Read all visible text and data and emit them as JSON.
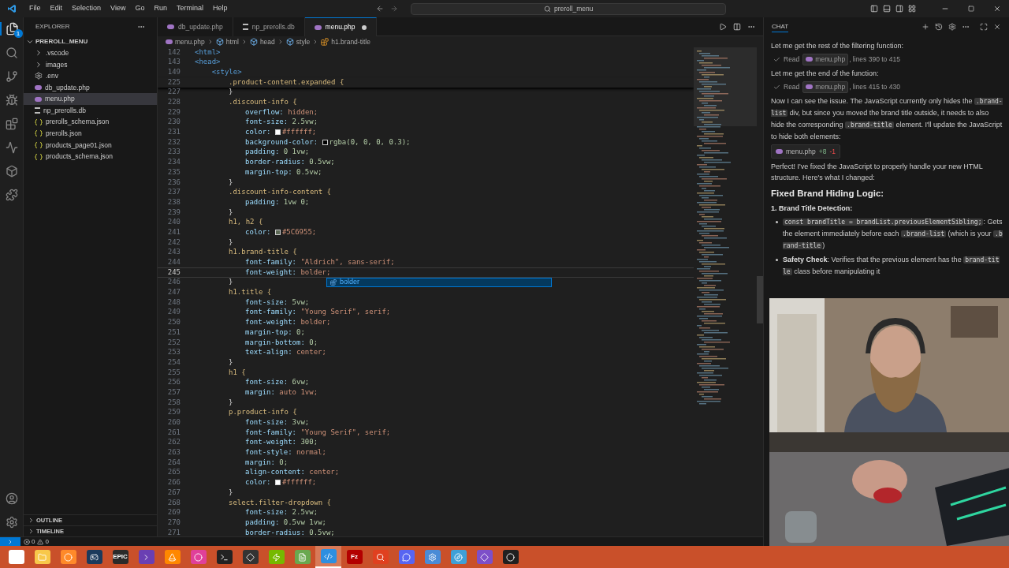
{
  "menu": [
    "File",
    "Edit",
    "Selection",
    "View",
    "Go",
    "Run",
    "Terminal",
    "Help"
  ],
  "command_center": {
    "text": "preroll_menu"
  },
  "activity_badge": "1",
  "explorer": {
    "title": "EXPLORER",
    "root": "PREROLL_MENU",
    "items": [
      {
        "label": ".vscode",
        "kind": "folder",
        "selected": false
      },
      {
        "label": "images",
        "kind": "folder",
        "selected": false
      },
      {
        "label": ".env",
        "kind": "env",
        "selected": false
      },
      {
        "label": "db_update.php",
        "kind": "php",
        "selected": false
      },
      {
        "label": "menu.php",
        "kind": "php",
        "selected": true
      },
      {
        "label": "np_prerolls.db",
        "kind": "db",
        "selected": false
      },
      {
        "label": "prerolls_schema.json",
        "kind": "json",
        "selected": false
      },
      {
        "label": "prerolls.json",
        "kind": "json",
        "selected": false
      },
      {
        "label": "products_page01.json",
        "kind": "json",
        "selected": false
      },
      {
        "label": "products_schema.json",
        "kind": "json",
        "selected": false
      }
    ]
  },
  "panels": [
    "OUTLINE",
    "TIMELINE"
  ],
  "tabs": [
    {
      "label": "db_update.php",
      "kind": "php",
      "selected": false,
      "modified": false
    },
    {
      "label": "np_prerolls.db",
      "kind": "db",
      "selected": false,
      "modified": false
    },
    {
      "label": "menu.php",
      "kind": "php",
      "selected": true,
      "modified": true
    }
  ],
  "breadcrumbs": [
    {
      "label": "menu.php",
      "kind": "php"
    },
    {
      "label": "html",
      "kind": "element"
    },
    {
      "label": "head",
      "kind": "element"
    },
    {
      "label": "style",
      "kind": "element"
    },
    {
      "label": "h1.brand-title",
      "kind": "rule"
    }
  ],
  "code": {
    "sticky": [
      {
        "n": "142",
        "kind": "tag",
        "text": "<html>",
        "current": false
      },
      {
        "n": "143",
        "kind": "tag",
        "text": "<head>",
        "current": false
      },
      {
        "n": "149",
        "kind": "tag",
        "text": "    <style>",
        "current": false
      },
      {
        "n": "225",
        "kind": "open",
        "text": ".product-content.expanded {",
        "current": false
      }
    ],
    "lines": [
      {
        "n": "227",
        "kind": "close",
        "text": "}",
        "current": false
      },
      {
        "n": "228",
        "kind": "open",
        "text": ".discount-info {",
        "current": false
      },
      {
        "n": "229",
        "kind": "decl",
        "prop": "overflow:",
        "value": "hidden;",
        "numeric": false,
        "current": false
      },
      {
        "n": "230",
        "kind": "decl",
        "prop": "font-size:",
        "value": "2.5vw;",
        "numeric": true,
        "current": false
      },
      {
        "n": "231",
        "kind": "decl",
        "prop": "color:",
        "value": "#ffffff;",
        "numeric": false,
        "color": "#ffffff",
        "current": false
      },
      {
        "n": "232",
        "kind": "decl",
        "prop": "background-color:",
        "value": "rgba(0, 0, 0, 0.3);",
        "numeric": true,
        "color": "#000000",
        "current": false
      },
      {
        "n": "233",
        "kind": "decl",
        "prop": "padding:",
        "value": "0 1vw;",
        "numeric": true,
        "current": false
      },
      {
        "n": "234",
        "kind": "decl",
        "prop": "border-radius:",
        "value": "0.5vw;",
        "numeric": true,
        "current": false
      },
      {
        "n": "235",
        "kind": "decl",
        "prop": "margin-top:",
        "value": "0.5vw;",
        "numeric": true,
        "current": false
      },
      {
        "n": "236",
        "kind": "close",
        "text": "}",
        "current": false
      },
      {
        "n": "237",
        "kind": "open",
        "text": ".discount-info-content {",
        "current": false
      },
      {
        "n": "238",
        "kind": "decl",
        "prop": "padding:",
        "value": "1vw 0;",
        "numeric": true,
        "current": false
      },
      {
        "n": "239",
        "kind": "close",
        "text": "}",
        "current": false
      },
      {
        "n": "240",
        "kind": "open",
        "text": "h1, h2 {",
        "current": false
      },
      {
        "n": "241",
        "kind": "decl",
        "prop": "color:",
        "value": "#5C6955;",
        "numeric": false,
        "color": "#5c6955",
        "current": false
      },
      {
        "n": "242",
        "kind": "close",
        "text": "}",
        "current": false
      },
      {
        "n": "243",
        "kind": "open",
        "text": "h1.brand-title {",
        "current": false
      },
      {
        "n": "244",
        "kind": "decl",
        "prop": "font-family:",
        "value": "\"Aldrich\", sans-serif;",
        "numeric": false,
        "current": false
      },
      {
        "n": "245",
        "kind": "decl",
        "prop": "font-weight:",
        "value": "bolder;",
        "numeric": false,
        "current": true
      },
      {
        "n": "246",
        "kind": "close",
        "text": "}",
        "current": false
      },
      {
        "n": "247",
        "kind": "open",
        "text": "h1.title {",
        "current": false
      },
      {
        "n": "248",
        "kind": "decl",
        "prop": "font-size:",
        "value": "5vw;",
        "numeric": true,
        "current": false
      },
      {
        "n": "249",
        "kind": "decl",
        "prop": "font-family:",
        "value": "\"Young Serif\", serif;",
        "numeric": false,
        "current": false
      },
      {
        "n": "250",
        "kind": "decl",
        "prop": "font-weight:",
        "value": "bolder;",
        "numeric": false,
        "current": false
      },
      {
        "n": "251",
        "kind": "decl",
        "prop": "margin-top:",
        "value": "0;",
        "numeric": true,
        "current": false
      },
      {
        "n": "252",
        "kind": "decl",
        "prop": "margin-bottom:",
        "value": "0;",
        "numeric": true,
        "current": false
      },
      {
        "n": "253",
        "kind": "decl",
        "prop": "text-align:",
        "value": "center;",
        "numeric": false,
        "current": false
      },
      {
        "n": "254",
        "kind": "close",
        "text": "}",
        "current": false
      },
      {
        "n": "255",
        "kind": "open",
        "text": "h1 {",
        "current": false
      },
      {
        "n": "256",
        "kind": "decl",
        "prop": "font-size:",
        "value": "6vw;",
        "numeric": true,
        "current": false
      },
      {
        "n": "257",
        "kind": "decl",
        "prop": "margin:",
        "value": "auto 1vw;",
        "numeric": false,
        "current": false
      },
      {
        "n": "258",
        "kind": "close",
        "text": "}",
        "current": false
      },
      {
        "n": "259",
        "kind": "open",
        "text": "p.product-info {",
        "current": false
      },
      {
        "n": "260",
        "kind": "decl",
        "prop": "font-size:",
        "value": "3vw;",
        "numeric": true,
        "current": false
      },
      {
        "n": "261",
        "kind": "decl",
        "prop": "font-family:",
        "value": "\"Young Serif\", serif;",
        "numeric": false,
        "current": false
      },
      {
        "n": "262",
        "kind": "decl",
        "prop": "font-weight:",
        "value": "300;",
        "numeric": true,
        "current": false
      },
      {
        "n": "263",
        "kind": "decl",
        "prop": "font-style:",
        "value": "normal;",
        "numeric": false,
        "current": false
      },
      {
        "n": "264",
        "kind": "decl",
        "prop": "margin:",
        "value": "0;",
        "numeric": true,
        "current": false
      },
      {
        "n": "265",
        "kind": "decl",
        "prop": "align-content:",
        "value": "center;",
        "numeric": false,
        "current": false
      },
      {
        "n": "266",
        "kind": "decl",
        "prop": "color:",
        "value": "#ffffff;",
        "numeric": false,
        "color": "#ffffff",
        "current": false
      },
      {
        "n": "267",
        "kind": "close",
        "text": "}",
        "current": false
      },
      {
        "n": "268",
        "kind": "open",
        "text": "select.filter-dropdown {",
        "current": false
      },
      {
        "n": "269",
        "kind": "decl",
        "prop": "font-size:",
        "value": "2.5vw;",
        "numeric": true,
        "current": false
      },
      {
        "n": "270",
        "kind": "decl",
        "prop": "padding:",
        "value": "0.5vw 1vw;",
        "numeric": true,
        "current": false
      },
      {
        "n": "271",
        "kind": "decl",
        "prop": "border-radius:",
        "value": "0.5vw;",
        "numeric": true,
        "current": false
      }
    ]
  },
  "suggestion": {
    "label": "bolder"
  },
  "chat": {
    "title": "CHAT",
    "items": [
      {
        "kind": "text",
        "parts": [
          {
            "kind": "text",
            "t": "Let me get the rest of the filtering function:"
          }
        ]
      },
      {
        "kind": "read",
        "verb": "Read",
        "file": "menu.php",
        "range": ", lines 390 to 415"
      },
      {
        "kind": "text",
        "parts": [
          {
            "kind": "text",
            "t": "Let me get the end of the function:"
          }
        ]
      },
      {
        "kind": "read",
        "verb": "Read",
        "file": "menu.php",
        "range": ", lines 415 to 430"
      },
      {
        "kind": "text",
        "parts": [
          {
            "kind": "text",
            "t": "Now I can see the issue. The JavaScript currently only hides the "
          },
          {
            "kind": "code",
            "t": ".brand-list"
          },
          {
            "kind": "text",
            "t": " div, but since you moved the brand title outside, it needs to also hide the corresponding "
          },
          {
            "kind": "code",
            "t": ".brand-title"
          },
          {
            "kind": "text",
            "t": " element. I'll update the JavaScript to hide both elements:"
          }
        ]
      },
      {
        "kind": "edit",
        "file": "menu.php",
        "added": "+8",
        "removed": "-1"
      },
      {
        "kind": "text",
        "parts": [
          {
            "kind": "text",
            "t": "Perfect! I've fixed the JavaScript to properly handle your new HTML structure. Here's what I changed:"
          }
        ]
      },
      {
        "kind": "heading",
        "text": "Fixed Brand Hiding Logic:"
      },
      {
        "kind": "subheading",
        "text": "1. Brand Title Detection:"
      },
      {
        "kind": "bullet",
        "parts": [
          {
            "kind": "code",
            "t": "const brandTitle = brandList.previousElementSibling;"
          },
          {
            "kind": "text",
            "t": ": Gets the element immediately before each "
          },
          {
            "kind": "code",
            "t": ".brand-list"
          },
          {
            "kind": "text",
            "t": " (which is your "
          },
          {
            "kind": "code",
            "t": ".brand-title"
          },
          {
            "kind": "text",
            "t": ")"
          }
        ]
      },
      {
        "kind": "bullet",
        "parts": [
          {
            "kind": "bold",
            "t": "Safety Check"
          },
          {
            "kind": "text",
            "t": ": Verifies that the previous element has the "
          },
          {
            "kind": "code",
            "t": "brand-title"
          },
          {
            "kind": "text",
            "t": " class before manipulating it"
          }
        ]
      }
    ]
  },
  "status": {
    "errors": "0",
    "warnings": "0"
  },
  "taskbar": [
    {
      "kind": "start",
      "selected": false
    },
    {
      "kind": "folder",
      "selected": false
    },
    {
      "kind": "browser",
      "selected": false
    },
    {
      "kind": "steam",
      "selected": false
    },
    {
      "kind": "epic",
      "text": "EPIC",
      "selected": false
    },
    {
      "kind": "shell",
      "selected": false
    },
    {
      "kind": "cone",
      "selected": false
    },
    {
      "kind": "wamp",
      "selected": false
    },
    {
      "kind": "terminal",
      "selected": false
    },
    {
      "kind": "pen",
      "selected": false
    },
    {
      "kind": "nvidia",
      "selected": false
    },
    {
      "kind": "notepad",
      "selected": false
    },
    {
      "kind": "vscode",
      "selected": true
    },
    {
      "kind": "filezilla",
      "text": "Fz",
      "selected": false
    },
    {
      "kind": "magnifier",
      "selected": false
    },
    {
      "kind": "chat",
      "selected": false
    },
    {
      "kind": "gear",
      "selected": false
    },
    {
      "kind": "compass",
      "selected": false
    },
    {
      "kind": "diamond",
      "selected": false
    },
    {
      "kind": "record",
      "selected": false
    }
  ]
}
